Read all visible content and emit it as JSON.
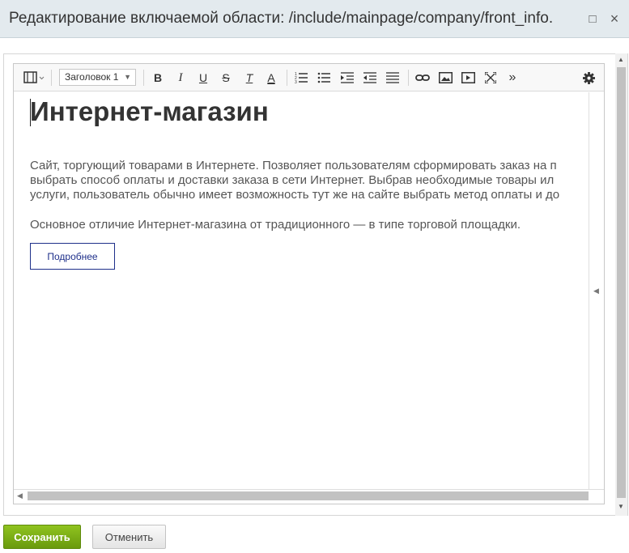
{
  "window": {
    "title": "Редактирование включаемой области: /include/mainpage/company/front_info.",
    "maximize_glyph": "□",
    "close_glyph": "×"
  },
  "toolbar": {
    "format_select_value": "Заголовок 1",
    "icons": [
      "view-mode-icon",
      "bold-icon",
      "italic-icon",
      "underline-icon",
      "strikethrough-icon",
      "remove-format-icon",
      "font-color-icon",
      "ordered-list-icon",
      "unordered-list-icon",
      "indent-icon",
      "outdent-icon",
      "align-icon",
      "link-icon",
      "image-icon",
      "video-icon",
      "fullscreen-icon",
      "more-icon",
      "settings-icon"
    ],
    "bold": "B",
    "italic": "I",
    "underline": "U",
    "strike": "S",
    "remove_format": "T",
    "font_color": "A",
    "more": "»"
  },
  "content": {
    "heading": "Интернет-магазин",
    "paragraph1_lines": [
      "Сайт, торгующий товарами в Интернете. Позволяет пользователям сформировать заказ на п",
      "выбрать способ оплаты и доставки заказа в сети Интернет. Выбрав необходимые товары ил",
      "услуги, пользователь обычно имеет возможность тут же на сайте выбрать метод оплаты и до"
    ],
    "paragraph2": "Основное отличие Интернет-магазина от традиционного — в типе торговой площадки.",
    "more_button_label": "Подробнее"
  },
  "footer": {
    "save_label": "Сохранить",
    "cancel_label": "Отменить"
  },
  "colors": {
    "save_button": "#7cae16",
    "more_button_border": "#1e2f8a",
    "titlebar": "#e3eaee"
  }
}
